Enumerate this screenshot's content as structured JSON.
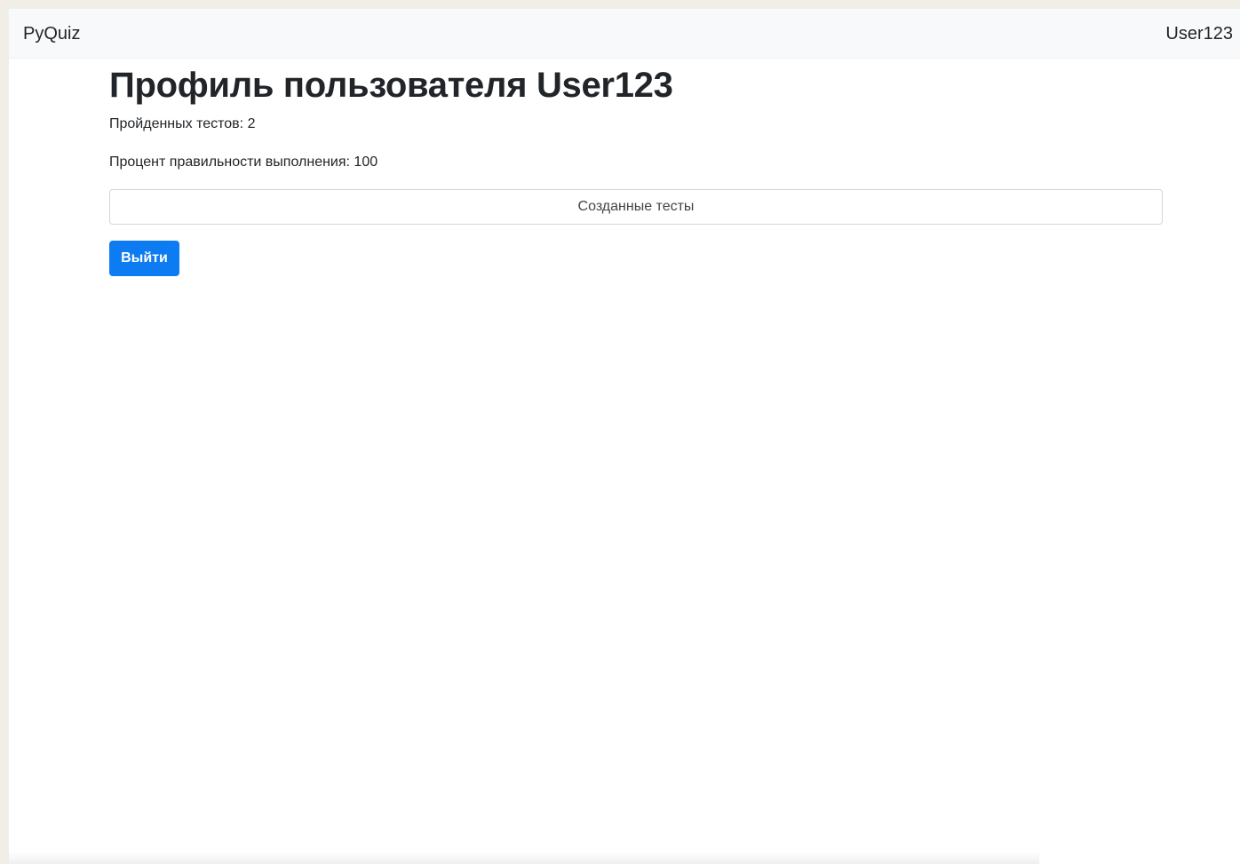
{
  "navbar": {
    "brand": "PyQuiz",
    "user": "User123"
  },
  "profile": {
    "title": "Профиль пользователя User123",
    "passed_tests": "Пройденных тестов: 2",
    "success_percent": "Процент правильности выполнения: 100",
    "created_tests_label": "Созданные тесты",
    "logout_label": "Выйти"
  },
  "colors": {
    "primary": "#0d7cf2",
    "navbar_bg": "#f8f9fa",
    "text": "#212529"
  }
}
